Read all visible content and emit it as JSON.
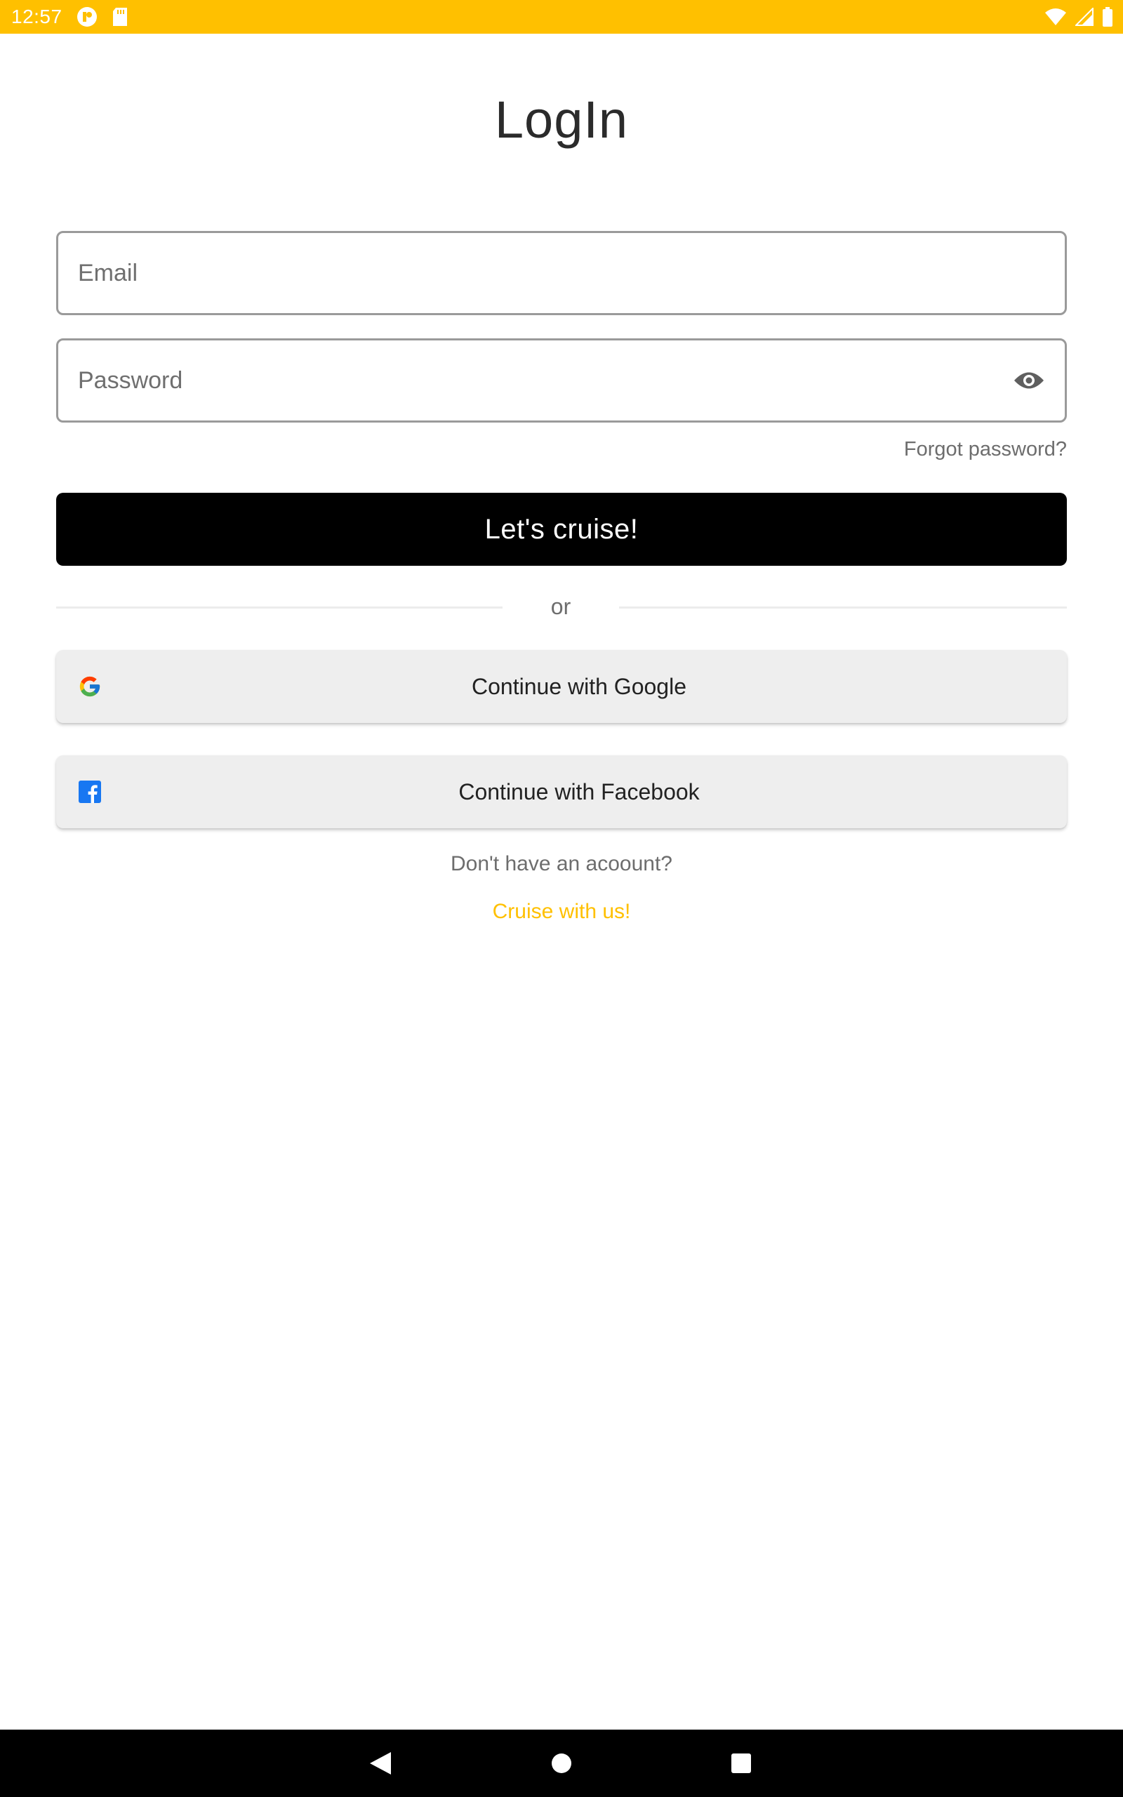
{
  "status_bar": {
    "time": "12:57",
    "background_color": "#FFC000",
    "left_icons": [
      "app-notification-icon",
      "sd-card-icon"
    ],
    "right_icons": [
      "wifi-icon",
      "signal-icon",
      "battery-icon"
    ]
  },
  "title": "LogIn",
  "email_field": {
    "placeholder": "Email",
    "value": ""
  },
  "password_field": {
    "placeholder": "Password",
    "value": "",
    "toggle_icon": "eye-icon"
  },
  "forgot_password": "Forgot password?",
  "primary_button": {
    "label": "Let's cruise!",
    "color": "#000000"
  },
  "divider_text": "or",
  "social": {
    "google": {
      "label": "Continue with Google",
      "icon": "google-icon"
    },
    "facebook": {
      "label": "Continue with Facebook",
      "icon": "facebook-icon"
    }
  },
  "signup": {
    "prompt": "Don't have an acoount?",
    "link": "Cruise with us!",
    "link_color": "#FFC000"
  },
  "nav_bar": {
    "icons": [
      "back-icon",
      "home-icon",
      "recents-icon"
    ]
  }
}
